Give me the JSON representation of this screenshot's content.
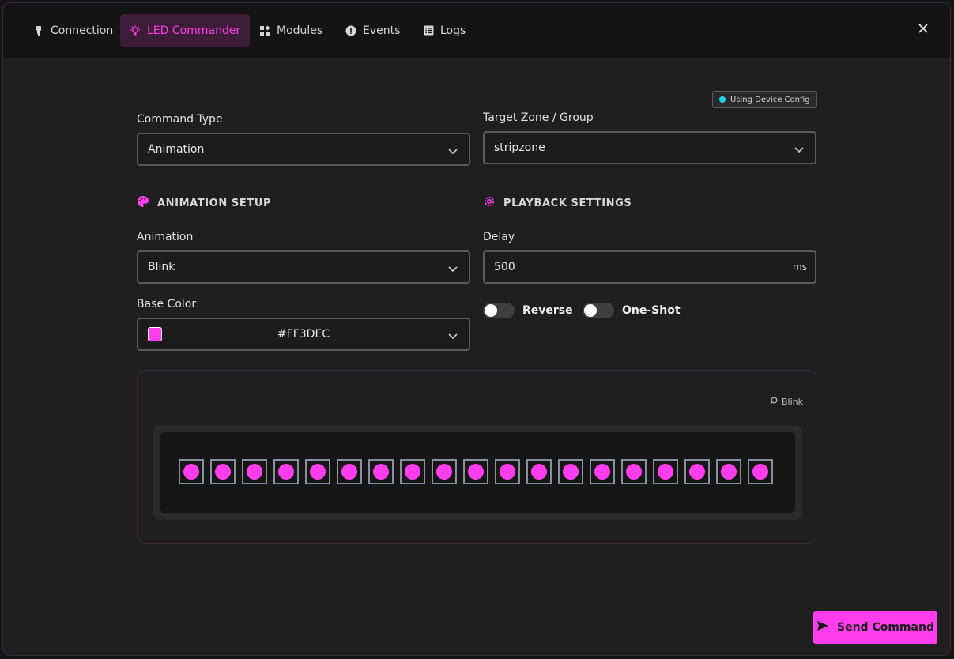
{
  "tabs": [
    {
      "label": "Connection",
      "icon": "plug-icon"
    },
    {
      "label": "LED Commander",
      "icon": "bulb-icon",
      "active": true
    },
    {
      "label": "Modules",
      "icon": "widgets-icon"
    },
    {
      "label": "Events",
      "icon": "alert-circle-icon"
    },
    {
      "label": "Logs",
      "icon": "list-icon"
    }
  ],
  "badge": {
    "text": "Using Device Config",
    "dot_color": "#22d3ee"
  },
  "command_type": {
    "label": "Command Type",
    "value": "Animation"
  },
  "target_zone": {
    "label": "Target Zone / Group",
    "value": "stripzone"
  },
  "animation_setup": {
    "title": "ANIMATION SETUP",
    "animation_label": "Animation",
    "animation_value": "Blink",
    "base_color_label": "Base Color",
    "base_color_value": "#FF3DEC"
  },
  "playback": {
    "title": "PLAYBACK SETTINGS",
    "delay_label": "Delay",
    "delay_value": "500",
    "delay_unit": "ms",
    "reverse_label": "Reverse",
    "reverse_on": false,
    "oneshot_label": "One-Shot",
    "oneshot_on": false
  },
  "preview": {
    "tag": "Blink",
    "led_count": 19,
    "led_color": "#ff3dec"
  },
  "footer": {
    "send_label": "Send Command"
  },
  "colors": {
    "accent": "#ff3dec"
  }
}
